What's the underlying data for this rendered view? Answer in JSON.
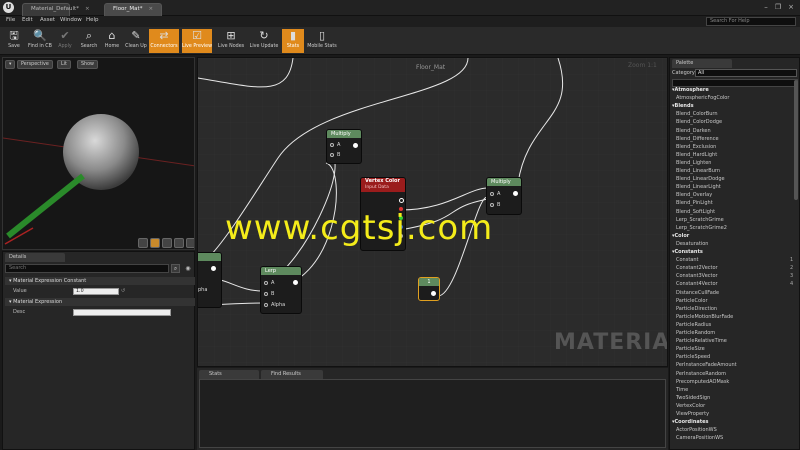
{
  "app": {
    "logo": "U"
  },
  "tabs": [
    {
      "label": "Material_Default*",
      "close": "×"
    },
    {
      "label": "Floor_Mat*",
      "close": "×"
    }
  ],
  "window_controls": [
    "–",
    "❐",
    "×"
  ],
  "menu": [
    "File",
    "Edit",
    "Asset",
    "Window",
    "Help"
  ],
  "search_help": {
    "placeholder": "Search For Help"
  },
  "toolbar": [
    {
      "label": "Save",
      "icon": "save-icon",
      "glyph": "🖫",
      "active": false
    },
    {
      "label": "Find in CB",
      "icon": "magnifier-icon",
      "glyph": "🔍",
      "active": false
    },
    {
      "label": "Apply",
      "icon": "checkmark-icon",
      "glyph": "✔",
      "active": false,
      "dim": true
    },
    {
      "label": "Search",
      "icon": "binoculars-icon",
      "glyph": "⌕",
      "active": false
    },
    {
      "label": "Home",
      "icon": "home-icon",
      "glyph": "⌂",
      "active": false
    },
    {
      "label": "Clean Up",
      "icon": "broom-icon",
      "glyph": "✎",
      "active": false
    },
    {
      "label": "Connectors",
      "icon": "connectors-icon",
      "glyph": "⇄",
      "active": true
    },
    {
      "label": "Live Preview",
      "icon": "checkbox-icon",
      "glyph": "☑",
      "active": true
    },
    {
      "label": "Live Nodes",
      "icon": "nodes-icon",
      "glyph": "⊞",
      "active": false
    },
    {
      "label": "Live Update",
      "icon": "update-icon",
      "glyph": "↻",
      "active": false
    },
    {
      "label": "Stats",
      "icon": "stats-icon",
      "glyph": "▮",
      "active": true
    },
    {
      "label": "Mobile Stats",
      "icon": "mobile-icon",
      "glyph": "▯",
      "active": false
    }
  ],
  "viewport": {
    "buttons": [
      "Perspective",
      "Lit",
      "Show"
    ]
  },
  "details": {
    "tab": "Details",
    "search_placeholder": "Search",
    "section1": "Material Expression Constant",
    "value_label": "Value",
    "value": "1.0",
    "section2": "Material Expression",
    "desc_label": "Desc"
  },
  "graph": {
    "title": "Floor_Mat",
    "zoom": "Zoom 1:1",
    "watermark": "MATERIAL",
    "nodes": {
      "multiply1": {
        "title": "Multiply",
        "a": "A",
        "b": "B"
      },
      "vertex_color": {
        "title": "Vertex Color",
        "subtitle": "Input Data"
      },
      "multiply2": {
        "title": "Multiply",
        "a": "A",
        "b": "B"
      },
      "lerp": {
        "title": "Lerp",
        "a": "A",
        "b": "B",
        "alpha": "Alpha"
      },
      "left_partial": {
        "label": "pha"
      },
      "constant": {
        "title": "1"
      }
    }
  },
  "bottom": {
    "tab1": "Stats",
    "tab2": "Find Results"
  },
  "palette": {
    "tab": "Palette",
    "category_label": "Category:",
    "category_value": "All",
    "items": [
      {
        "t": "Atmosphere",
        "cat": true
      },
      {
        "t": "AtmosphericFogColor"
      },
      {
        "t": "Blends",
        "cat": true
      },
      {
        "t": "Blend_ColorBurn"
      },
      {
        "t": "Blend_ColorDodge"
      },
      {
        "t": "Blend_Darken"
      },
      {
        "t": "Blend_Difference"
      },
      {
        "t": "Blend_Exclusion"
      },
      {
        "t": "Blend_HardLight"
      },
      {
        "t": "Blend_Lighten"
      },
      {
        "t": "Blend_LinearBurn"
      },
      {
        "t": "Blend_LinearDodge"
      },
      {
        "t": "Blend_LinearLight"
      },
      {
        "t": "Blend_Overlay"
      },
      {
        "t": "Blend_PinLight"
      },
      {
        "t": "Blend_SoftLight"
      },
      {
        "t": "Lerp_ScratchGrime"
      },
      {
        "t": "Lerp_ScratchGrime2"
      },
      {
        "t": "Color",
        "cat": true
      },
      {
        "t": "Desaturation"
      },
      {
        "t": "Constants",
        "cat": true
      },
      {
        "t": "Constant",
        "hot": "1"
      },
      {
        "t": "Constant2Vector",
        "hot": "2"
      },
      {
        "t": "Constant3Vector",
        "hot": "3"
      },
      {
        "t": "Constant4Vector",
        "hot": "4"
      },
      {
        "t": "DistanceCullFade"
      },
      {
        "t": "ParticleColor"
      },
      {
        "t": "ParticleDirection"
      },
      {
        "t": "ParticleMotionBlurFade"
      },
      {
        "t": "ParticleRadius"
      },
      {
        "t": "ParticleRandom"
      },
      {
        "t": "ParticleRelativeTime"
      },
      {
        "t": "ParticleSize"
      },
      {
        "t": "ParticleSpeed"
      },
      {
        "t": "PerInstanceFadeAmount"
      },
      {
        "t": "PerInstanceRandom"
      },
      {
        "t": "PrecomputedAOMask"
      },
      {
        "t": "Time"
      },
      {
        "t": "TwoSidedSign"
      },
      {
        "t": "VertexColor"
      },
      {
        "t": "ViewProperty"
      },
      {
        "t": "Coordinates",
        "cat": true
      },
      {
        "t": "ActorPositionWS"
      },
      {
        "t": "CameraPositionWS"
      }
    ]
  },
  "watermark_overlay": "www.cgtsj.com",
  "colors": {
    "accent": "#e08a1c",
    "multiply_header": "#5e8a5e",
    "vertex_header": "#9a1c1c",
    "lerp_header": "#5e8a5e",
    "constant_header": "#5e8a5e"
  }
}
